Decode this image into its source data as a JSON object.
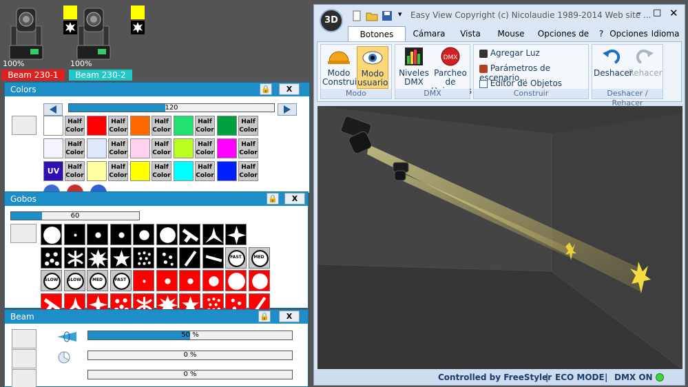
{
  "fixtures": [
    {
      "percent": "100%",
      "name": "Beam 230-1",
      "name_bg": "#e02020"
    },
    {
      "percent": "100%",
      "name": "Beam 230-2",
      "name_bg": "#20c8c8"
    }
  ],
  "colors_panel": {
    "title": "Colors",
    "lock_icon": "lock-icon",
    "close_label": "X",
    "slider_value": "120",
    "slider_fraction": 0.47,
    "uv_label": "UV",
    "half_label_line1": "Half",
    "half_label_line2": "Color",
    "swatches": {
      "row1": [
        "#ffffff",
        "#ff0000",
        "#ff6a00",
        "#22e070",
        "#00a040"
      ],
      "row2": [
        "#f4f4ff",
        "#dde8ff",
        "#ffd0f0",
        "#bbff22",
        "#ff00ff"
      ],
      "row3": [
        "#3010b0",
        "#ffffa0",
        "#ffff00",
        "#00ffff",
        "#0020ff"
      ]
    }
  },
  "gobos_panel": {
    "title": "Gobos",
    "close_label": "X",
    "slider_value": "60",
    "slider_fraction": 0.24,
    "speed_labels": [
      "FAST",
      "MED",
      "SLOW",
      "SLOW",
      "MED",
      "FAST"
    ]
  },
  "beam_panel": {
    "title": "Beam",
    "close_label": "X",
    "bars": [
      {
        "value": "50 %",
        "fraction": 0.5
      },
      {
        "value": "0 %",
        "fraction": 0
      },
      {
        "value": "0 %",
        "fraction": 0
      }
    ]
  },
  "app": {
    "logo_label": "3D",
    "title": "Easy View   Copyright (c) Nicolaudie 1989-2014   Web site ...",
    "tabs": [
      "Botones están",
      "Cámara",
      "Vista",
      "Mouse",
      "Opciones de re",
      "?",
      "Opciones",
      "Idioma"
    ],
    "groups": {
      "modo": {
        "caption": "Modo",
        "btn1": [
          "Modo",
          "Construir"
        ],
        "btn2": [
          "Modo",
          "usuario"
        ]
      },
      "dmx": {
        "caption": "DMX",
        "btn1": [
          "Niveles",
          "DMX"
        ],
        "btn2": [
          "Parcheo de",
          "Universos"
        ]
      },
      "construir": {
        "caption": "Construir",
        "items": [
          "Agregar Luz",
          "Parámetros de escenario...",
          "Editor de Objetos simples"
        ]
      },
      "undo": {
        "caption": "Deshacer / Rehacer",
        "undo": "Deshacer",
        "redo": "Rehacer"
      }
    },
    "status": {
      "controlled": "Controlled by FreeStyler",
      "eco": "ECO MODE",
      "dmx": "DMX ON",
      "sep": "|"
    }
  }
}
